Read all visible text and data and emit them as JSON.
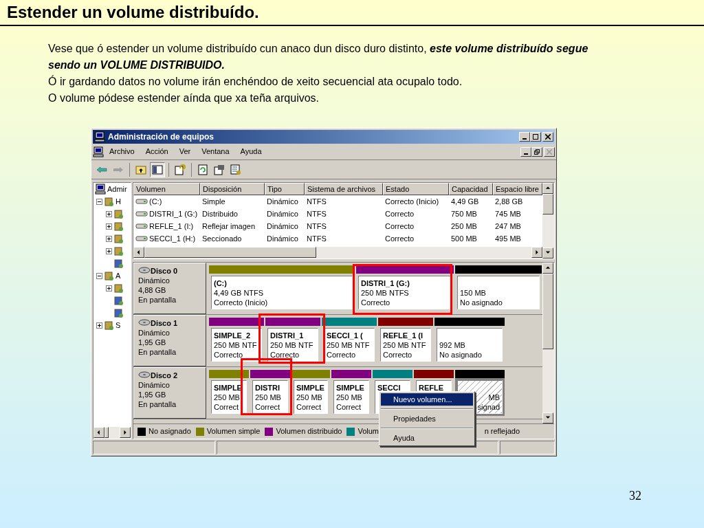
{
  "slide": {
    "title": "Estender un volume distribuído.",
    "paragraphs": [
      "Vese que ó estender un volume distribuído cun anaco dun disco duro distinto, **este volume distribuído segue sendo un VOLUME DISTRIBUIDO.**",
      "Ó ir gardando datos no volume irán enchéndoo de xeito secuencial ata ocupalo todo.",
      "O volume pódese estender aínda que xa teña arquivos."
    ],
    "page_number": "32"
  },
  "window": {
    "title": "Administración de equipos",
    "menu": [
      "Archivo",
      "Acción",
      "Ver",
      "Ventana",
      "Ayuda"
    ],
    "tree": [
      {
        "label": "Admir",
        "children": [
          {
            "label": "H",
            "kind": "folder",
            "expanded": true,
            "children": [
              {
                "kind": "folder",
                "expanded": false
              },
              {
                "kind": "folder",
                "expanded": false
              },
              {
                "kind": "folder",
                "expanded": false
              },
              {
                "kind": "folder",
                "expanded": false
              },
              {
                "kind": "leaf"
              }
            ]
          },
          {
            "label": "A",
            "kind": "folder",
            "expanded": true,
            "children": [
              {
                "kind": "folder",
                "expanded": false
              },
              {
                "kind": "leaf"
              },
              {
                "kind": "leaf"
              }
            ]
          },
          {
            "label": "S",
            "kind": "folder",
            "expanded": false
          }
        ]
      }
    ],
    "table": {
      "columns": [
        "Volumen",
        "Disposición",
        "Tipo",
        "Sistema de archivos",
        "Estado",
        "Capacidad",
        "Espacio libre"
      ],
      "rows": [
        [
          "(C:)",
          "Simple",
          "Dinámico",
          "NTFS",
          "Correcto (Inicio)",
          "4,49 GB",
          "2,88 GB"
        ],
        [
          "DISTRI_1 (G:)",
          "Distribuido",
          "Dinámico",
          "NTFS",
          "Correcto",
          "750 MB",
          "745 MB"
        ],
        [
          "REFLE_1 (I:)",
          "Reflejar imagen",
          "Dinámico",
          "NTFS",
          "Correcto",
          "250 MB",
          "247 MB"
        ],
        [
          "SECCI_1 (H:)",
          "Seccionado",
          "Dinámico",
          "NTFS",
          "Correcto",
          "500 MB",
          "495 MB"
        ]
      ]
    },
    "disks": [
      {
        "name": "Disco 0",
        "type": "Dinámico",
        "size": "4,88 GB",
        "status": "En pantalla",
        "partitions": [
          {
            "color": "#808000",
            "title": "(C:)",
            "lines": [
              "4,49 GB NTFS",
              "Correcto (Inicio)"
            ],
            "selected": false
          },
          {
            "color": "#800080",
            "title": "DISTRI_1  (G:)",
            "lines": [
              "250 MB NTFS",
              "Correcto"
            ],
            "selected": false
          },
          {
            "color": "#000000",
            "lines": [
              "150 MB",
              "No asignado"
            ],
            "selected": false
          }
        ]
      },
      {
        "name": "Disco 1",
        "type": "Dinámico",
        "size": "1,95 GB",
        "status": "En pantalla",
        "partitions": [
          {
            "color": "#800080",
            "title": "SIMPLE_2",
            "lines": [
              "250 MB NTF",
              "Correcto"
            ],
            "selected": false
          },
          {
            "color": "#800080",
            "title": "DISTRI_1",
            "lines": [
              "250 MB NTF",
              "Correcto"
            ],
            "selected": false
          },
          {
            "color": "#008080",
            "title": "SECCI_1  (",
            "lines": [
              "250 MB NTF",
              "Correcto"
            ],
            "selected": false
          },
          {
            "color": "#800000",
            "title": "REFLE_1  (I",
            "lines": [
              "250 MB NTF",
              "Correcto"
            ],
            "selected": false
          },
          {
            "color": "#000000",
            "lines": [
              "992 MB",
              "No asignado"
            ],
            "selected": false
          }
        ]
      },
      {
        "name": "Disco 2",
        "type": "Dinámico",
        "size": "1,95 GB",
        "status": "En pantalla",
        "partitions": [
          {
            "color": "#808000",
            "title": "SIMPLE",
            "lines": [
              "250 MB",
              "Correct"
            ],
            "selected": false
          },
          {
            "color": "#800080",
            "title": "DISTRI",
            "lines": [
              "250 MB",
              "Correct"
            ],
            "selected": false
          },
          {
            "color": "#808000",
            "title": "SIMPLE",
            "lines": [
              "250 MB",
              "Correct"
            ],
            "selected": false
          },
          {
            "color": "#800080",
            "title": "SIMPLE",
            "lines": [
              "250 MB",
              "Correct"
            ],
            "selected": false
          },
          {
            "color": "#008080",
            "title": "SECCI",
            "selected": false
          },
          {
            "color": "#800000",
            "title": "REFLE",
            "selected": false
          },
          {
            "color": "#000000",
            "lines": [
              "MB",
              "signad"
            ],
            "selected": true
          }
        ]
      }
    ],
    "legend": [
      {
        "label": "No asignado",
        "color": "#000000"
      },
      {
        "label": "Volumen simple",
        "color": "#808000"
      },
      {
        "label": "Volumen distribuido",
        "color": "#800080"
      },
      {
        "label": "Volum",
        "color": "#008080"
      }
    ],
    "legend_tail": "n reflejado",
    "context_menu": [
      {
        "label": "Nuevo volumen...",
        "selected": true
      },
      {
        "label": "Propiedades",
        "selected": false
      },
      {
        "label": "Ayuda",
        "selected": false
      }
    ]
  }
}
